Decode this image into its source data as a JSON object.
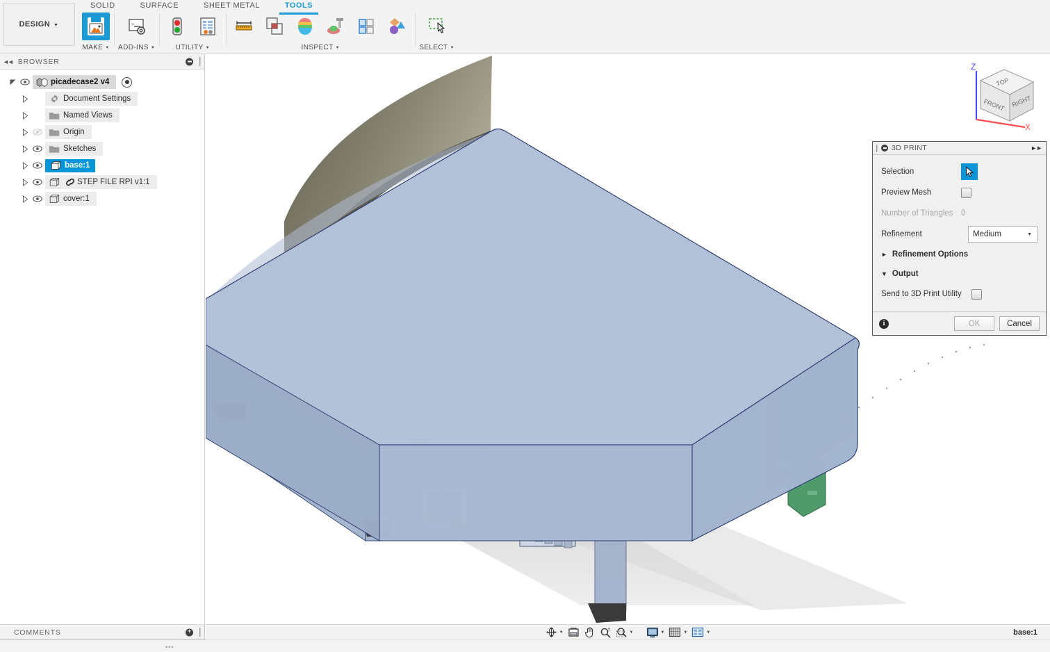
{
  "app": {
    "workspace_label": "DESIGN",
    "tabs": [
      {
        "label": "SOLID",
        "active": false
      },
      {
        "label": "SURFACE",
        "active": false
      },
      {
        "label": "SHEET METAL",
        "active": false
      },
      {
        "label": "TOOLS",
        "active": true
      }
    ],
    "groups": [
      {
        "label": "MAKE",
        "icons": [
          "3d-print-icon"
        ]
      },
      {
        "label": "ADD-INS",
        "icons": [
          "scripts-and-addins-icon"
        ]
      },
      {
        "label": "UTILITY",
        "icons": [
          "compute-all-icon",
          "document-audit-icon"
        ]
      },
      {
        "label": "INSPECT",
        "icons": [
          "measure-icon",
          "interference-icon",
          "curvature-comb-icon",
          "zebra-analysis-icon",
          "section-analysis-icon",
          "component-color-toggle-icon"
        ]
      },
      {
        "label": "SELECT",
        "icons": [
          "select-window-icon"
        ]
      }
    ]
  },
  "browser": {
    "title": "BROWSER",
    "collapse_icon": "collapse-left-icon",
    "minimize_icon": "minimize-icon",
    "items": [
      {
        "label": "picadecase2 v4",
        "icon": "component-icon",
        "eye": true,
        "expander": "expanded",
        "selected_root": true,
        "radio": true,
        "depth": 0
      },
      {
        "label": "Document Settings",
        "icon": "gear-icon",
        "eye": false,
        "expander": "collapsed",
        "depth": 1
      },
      {
        "label": "Named Views",
        "icon": "folder-icon",
        "eye": false,
        "expander": "collapsed",
        "depth": 1
      },
      {
        "label": "Origin",
        "icon": "folder-icon",
        "eye": true,
        "eye_off": true,
        "expander": "collapsed",
        "depth": 1
      },
      {
        "label": "Sketches",
        "icon": "folder-icon",
        "eye": true,
        "expander": "collapsed",
        "depth": 1
      },
      {
        "label": "base:1",
        "icon": "body-icon",
        "eye": true,
        "expander": "collapsed",
        "selected": true,
        "depth": 1
      },
      {
        "label": "STEP FILE RPI v1:1",
        "icon": "body-icon",
        "eye": true,
        "expander": "collapsed",
        "linked": true,
        "depth": 1
      },
      {
        "label": "cover:1",
        "icon": "body-icon",
        "eye": true,
        "expander": "collapsed",
        "depth": 1
      }
    ]
  },
  "comments": {
    "title": "COMMENTS",
    "add_icon": "add-comment-icon"
  },
  "dialog": {
    "title": "3D PRINT",
    "minimize_icon": "minimize-icon",
    "expand_icon": "expand-right-icon",
    "rows": [
      {
        "label": "Selection",
        "control": "selection-button",
        "icon": "cursor-arrow-icon"
      },
      {
        "label": "Preview Mesh",
        "control": "checkbox",
        "checked": false
      },
      {
        "label": "Number of Triangles",
        "control": "readonly",
        "value": "0",
        "disabled": true
      },
      {
        "label": "Refinement",
        "control": "select",
        "value": "Medium"
      }
    ],
    "sections": [
      {
        "label": "Refinement Options",
        "expanded": false
      },
      {
        "label": "Output",
        "expanded": true
      }
    ],
    "output_rows": [
      {
        "label": "Send to 3D Print Utility",
        "control": "checkbox",
        "checked": false
      }
    ],
    "info_icon": "info-icon",
    "ok_label": "OK",
    "ok_disabled": true,
    "cancel_label": "Cancel"
  },
  "viewcube": {
    "faces": {
      "top": "TOP",
      "front": "FRONT",
      "right": "RIGHT"
    },
    "axes": {
      "z": "Z",
      "x": "X"
    },
    "z_color": "#4d4dff",
    "x_color": "#ff4d4d"
  },
  "navbar": {
    "items": [
      {
        "name": "orbit-icon",
        "dropdown": true
      },
      {
        "name": "look-at-icon",
        "dropdown": false
      },
      {
        "name": "pan-icon",
        "dropdown": false
      },
      {
        "name": "zoom-icon",
        "dropdown": false
      },
      {
        "name": "zoom-window-icon",
        "dropdown": true
      },
      {
        "name": "display-settings-icon",
        "dropdown": true
      },
      {
        "name": "grid-and-snaps-icon",
        "dropdown": true
      },
      {
        "name": "viewport-layout-icon",
        "dropdown": true
      }
    ]
  },
  "status": {
    "right_label": "base:1",
    "bottom_marks": "•••"
  },
  "theme": {
    "accent": "#0696d7",
    "tab_active": "#1c9ad6",
    "panel_bg": "#f2f2f2",
    "model_fill": "#aebdd6",
    "model_edge": "#2a3a6b",
    "model_dark": "#7d7a68",
    "pcb_green": "#4e9a6b",
    "select_green": "#3aa13a"
  }
}
